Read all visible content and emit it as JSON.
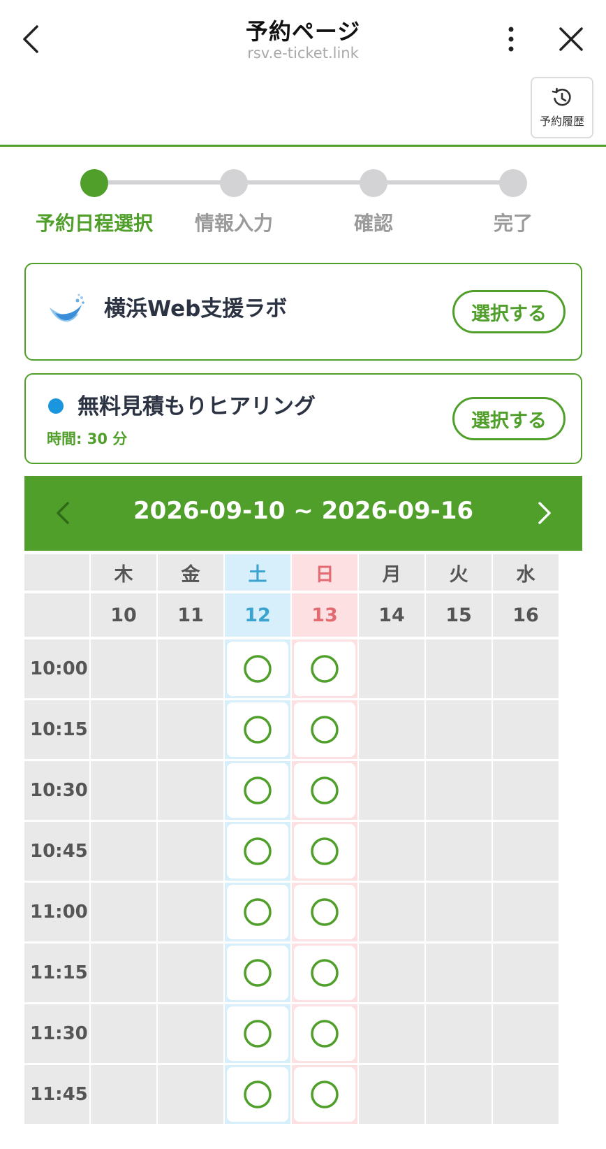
{
  "header": {
    "title": "予約ページ",
    "subtitle": "rsv.e-ticket.link",
    "history_label": "予約履歴"
  },
  "steps": [
    {
      "label": "予約日程選択",
      "active": true
    },
    {
      "label": "情報入力",
      "active": false
    },
    {
      "label": "確認",
      "active": false
    },
    {
      "label": "完了",
      "active": false
    }
  ],
  "organization": {
    "name": "横浜Web支援ラボ",
    "select_label": "選択する"
  },
  "service": {
    "name": "無料見積もりヒアリング",
    "duration": "時間: 30 分",
    "select_label": "選択する"
  },
  "calendar": {
    "range": "2026-09-10 ~ 2026-09-16",
    "weekdays": [
      "木",
      "金",
      "土",
      "日",
      "月",
      "火",
      "水"
    ],
    "dates": [
      "10",
      "11",
      "12",
      "13",
      "14",
      "15",
      "16"
    ],
    "times": [
      "10:00",
      "10:15",
      "10:30",
      "10:45",
      "11:00",
      "11:15",
      "11:30",
      "11:45"
    ],
    "available_mark": "○",
    "available_days": [
      "12",
      "13"
    ]
  },
  "colors": {
    "brand_green": "#4f9f2a",
    "saturday": "#3aa3cf",
    "sunday": "#e46a72",
    "service_dot": "#1a95de"
  }
}
